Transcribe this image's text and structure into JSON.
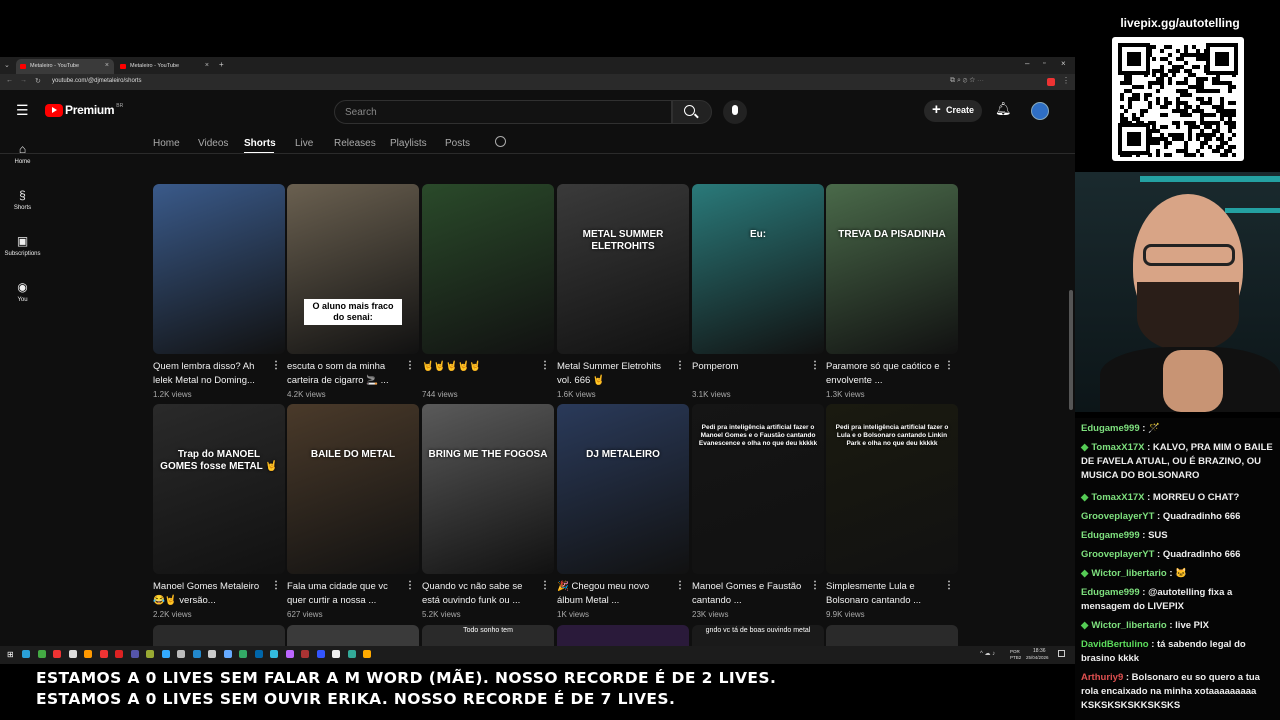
{
  "browser": {
    "tabs": [
      {
        "title": "Metaleiro - YouTube"
      },
      {
        "title": "Metaleiro - YouTube"
      }
    ],
    "url": "youtube.com/@djmetaleiro/shorts"
  },
  "youtube": {
    "logo": "Premium",
    "logo_region": "BR",
    "search_placeholder": "Search",
    "create_label": "Create",
    "sidebar": [
      {
        "label": "Home",
        "icon": "home-icon"
      },
      {
        "label": "Shorts",
        "icon": "shorts-icon"
      },
      {
        "label": "Subscriptions",
        "icon": "subscriptions-icon"
      },
      {
        "label": "You",
        "icon": "you-icon"
      }
    ],
    "channel_tabs": [
      "Home",
      "Videos",
      "Shorts",
      "Live",
      "Releases",
      "Playlists",
      "Posts"
    ],
    "active_tab": "Shorts",
    "shorts": [
      {
        "title": "Quem lembra disso? Ah lelek Metal no Doming...",
        "views": "1.2K views",
        "color": "#3a5a8a"
      },
      {
        "title": "escuta o som da minha carteira de cigarro 🚬 ...",
        "views": "4.2K views",
        "color": "#6a6050",
        "caption": "O aluno mais fraco do senai:"
      },
      {
        "title": "🤘🤘🤘🤘🤘",
        "views": "744 views",
        "color": "#2a4a2a"
      },
      {
        "title": "Metal Summer Eletrohits vol. 666 🤘",
        "views": "1.6K views",
        "color": "#3a3a3a",
        "overlay": "METAL SUMMER ELETROHITS"
      },
      {
        "title": "Pomperom",
        "views": "3.1K views",
        "color": "#2a7a7a",
        "overlay": "Eu:"
      },
      {
        "title": "Paramore só que caótico e envolvente ...",
        "views": "1.3K views",
        "color": "#4a6a4a",
        "overlay": "TREVA DA PISADINHA"
      },
      {
        "title": "Manoel Gomes Metaleiro 😂🤘 versão...",
        "views": "2.2K views",
        "color": "#2a2a2a",
        "overlay": "Trap do MANOEL GOMES fosse METAL 🤘"
      },
      {
        "title": "Fala uma cidade que vc quer curtir a nossa ...",
        "views": "627 views",
        "color": "#4a3a2a",
        "overlay": "BAILE DO METAL"
      },
      {
        "title": "Quando vc não sabe se está ouvindo funk ou ...",
        "views": "5.2K views",
        "color": "#5a5a5a",
        "overlay": "BRING ME THE FOGOSA"
      },
      {
        "title": "🎉 Chegou meu novo álbum Metal ...",
        "views": "1K views",
        "color": "#2a3a5a",
        "overlay": "DJ METALEIRO"
      },
      {
        "title": "Manoel Gomes e Faustão cantando ...",
        "views": "23K views",
        "color": "#151515",
        "overlay": "Pedi pra inteligência artificial fazer o Manoel Gomes e o Faustão cantando Evanescence e olha no que deu kkkkk"
      },
      {
        "title": "Simplesmente Lula e Bolsonaro cantando ...",
        "views": "9.9K views",
        "color": "#1a1a10",
        "overlay": "Pedi pra inteligência artificial fazer o Lula e o Bolsonaro cantando Linkin Park e olha no que deu kkkkk"
      }
    ],
    "partial_row": [
      {
        "color": "#2a2a2a"
      },
      {
        "color": "#3a3a3a"
      },
      {
        "color": "#2a2a2a",
        "overlay": "Todo sonho tem"
      },
      {
        "color": "#2a1a3a"
      },
      {
        "color": "#1a1a1a",
        "overlay": "gndo vc tá de boas ouvindo metal"
      },
      {
        "color": "#2a2a2a"
      }
    ]
  },
  "taskbar": {
    "lang": "POR PTB2",
    "time": "18:36",
    "date": "25/04/2026"
  },
  "stream": {
    "ticker_lines": [
      "ESTAMOS A 0 LIVES SEM FALAR A M WORD (MÃE). NOSSO RECORDE É DE 2 LIVES.",
      "ESTAMOS A 0 LIVES SEM OUVIR ERIKA. NOSSO RECORDE É DE 7 LIVES."
    ],
    "qr_label": "livepix.gg/autotelling",
    "chat": [
      {
        "user": "Edugame999",
        "text": " : 🪄",
        "badge": false
      },
      {
        "user": "TomaxX17X",
        "text": " : KALVO, PRA MIM O BAILE DE FAVELA ATUAL, OU É BRAZINO, OU MUSICA DO BOLSONARO",
        "badge": true
      },
      {
        "user": "TomaxX17X",
        "text": " : MORREU O CHAT?",
        "badge": true
      },
      {
        "user": "GrooveplayerYT",
        "text": " : Quadradinho 666",
        "badge": false
      },
      {
        "user": "Edugame999",
        "text": " : SUS",
        "badge": false
      },
      {
        "user": "GrooveplayerYT",
        "text": " : Quadradinho 666",
        "badge": false
      },
      {
        "user": "Wictor_libertario",
        "text": " : 🐱",
        "badge": true
      },
      {
        "user": "Edugame999",
        "text": " : @autotelling fixa a mensagem do LIVEPIX",
        "badge": false
      },
      {
        "user": "Wictor_libertario",
        "text": " : live PIX",
        "badge": true
      },
      {
        "user": "DavidBertulino",
        "text": " : tá sabendo legal do brasino kkkk",
        "badge": false
      },
      {
        "user": "Arthuriy9",
        "text": " : Bolsonaro eu so quero a tua rola encaixado na minha xotaaaaaaaaa KSKSKSKSKKSKSKS",
        "badge": false
      }
    ]
  }
}
